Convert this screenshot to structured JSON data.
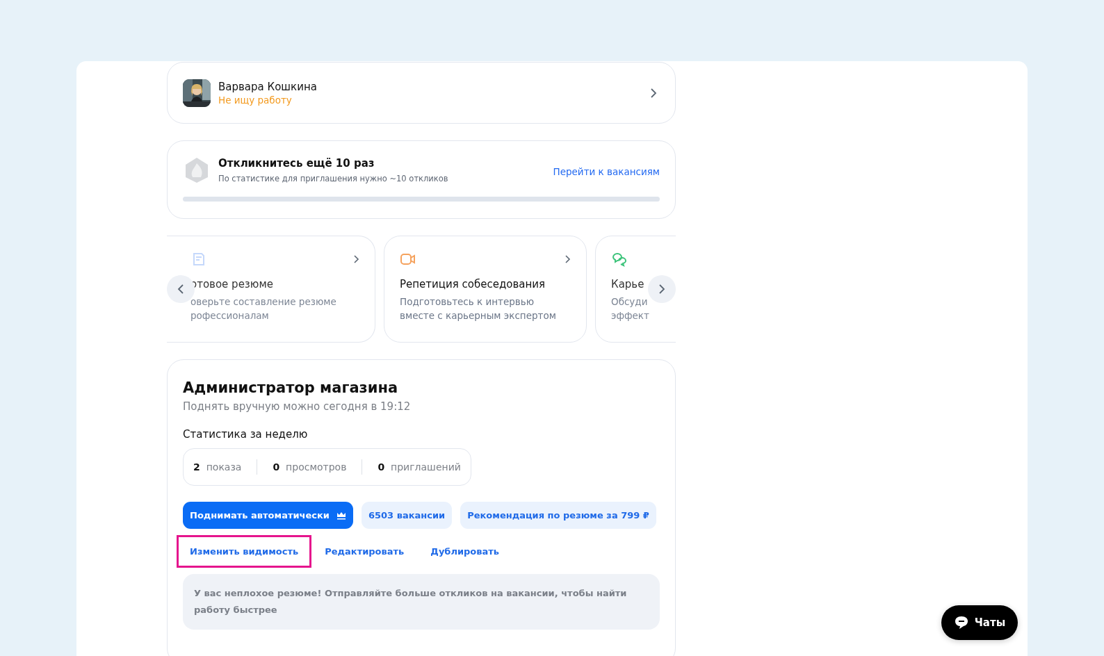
{
  "profile": {
    "name": "Варвара Кошкина",
    "status": "Не ищу работу"
  },
  "goal": {
    "title": "Откликнитесь ещё 10 раз",
    "subtitle": "По статистике для приглашения нужно ~10 откликов",
    "link": "Перейти к вакансиям",
    "level": 0
  },
  "services": [
    {
      "kind": "resume",
      "title": "отовое резюме",
      "lines": [
        "оверьте составление резюме",
        "рофессионалам"
      ]
    },
    {
      "kind": "interview",
      "title": "Репетиция собеседования",
      "lines": [
        "Подготовьтесь к интервью",
        "вместе с карьерным экспертом"
      ]
    },
    {
      "kind": "consult",
      "title": "Карье",
      "lines": [
        "Обсуди",
        "эффект"
      ]
    }
  ],
  "resume": {
    "title": "Администратор магазина",
    "subtitle": "Поднять вручную можно сегодня в 19:12",
    "stats_title": "Статистика за неделю",
    "stats": [
      {
        "value": "2",
        "label": "показа"
      },
      {
        "value": "0",
        "label": "просмотров"
      },
      {
        "value": "0",
        "label": "приглашений"
      }
    ],
    "buttons": [
      {
        "kind": "primary",
        "label": "Поднимать автоматически"
      },
      {
        "kind": "soft",
        "label": "6503 вакансии"
      },
      {
        "kind": "soft",
        "label": "Рекомендация по резюме за 799 ₽"
      }
    ],
    "actions": [
      {
        "label": "Изменить видимость",
        "highlighted": true
      },
      {
        "label": "Редактировать",
        "highlighted": false
      },
      {
        "label": "Дублировать",
        "highlighted": false
      }
    ],
    "notice": "У вас неплохое резюме! Отправляйте больше откликов на вакансии, чтобы найти работу быстрее"
  },
  "chat_button": {
    "label": "Чаты"
  }
}
